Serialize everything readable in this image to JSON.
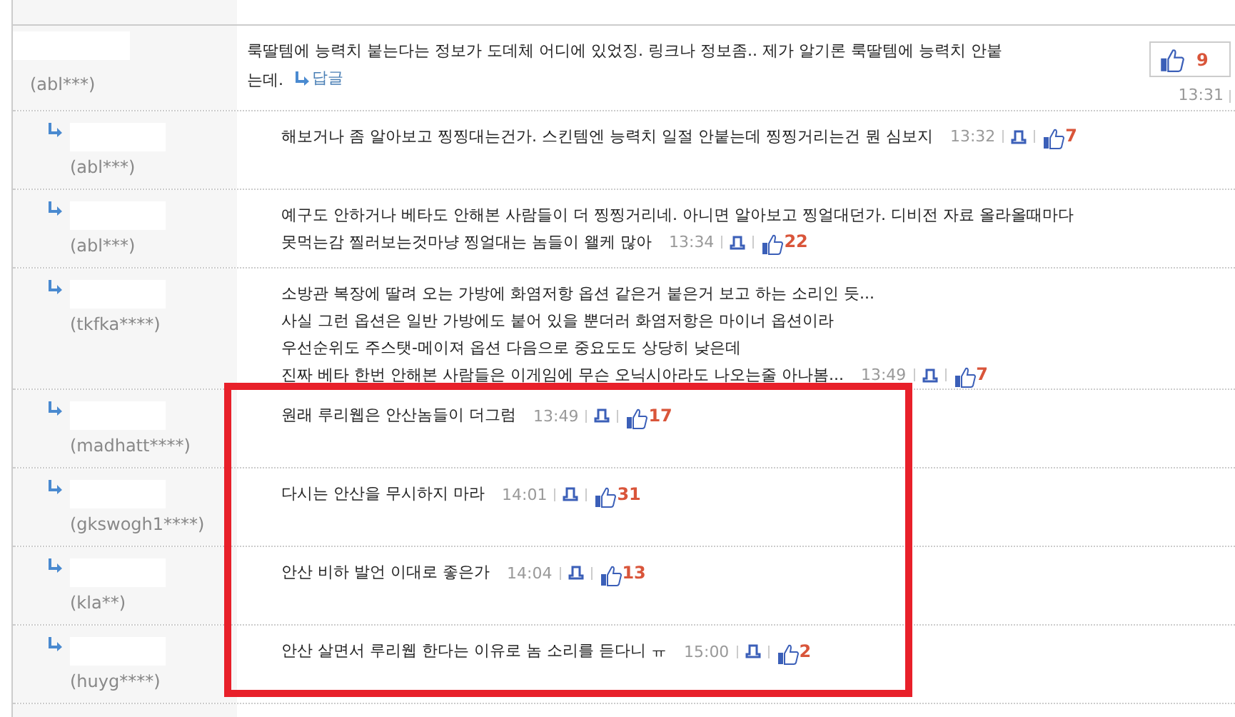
{
  "comments": [
    {
      "kind": "comment",
      "author": "(abl***)",
      "lines": [
        "룩딸템에 능력치 붙는다는 정보가 도데체 어디에 있었징. 링크나 정보좀.. 제가 알기론 룩딸템에 능력치 안붙",
        "는데."
      ],
      "reply_link": "답글",
      "time": "13:31",
      "likes": "9"
    },
    {
      "kind": "reply",
      "author": "(abl***)",
      "lines": [
        "해보거나 좀 알아보고 찡찡대는건가. 스킨템엔 능력치 일절 안붙는데 찡찡거리는건 뭔 심보지"
      ],
      "time": "13:32",
      "likes": "7"
    },
    {
      "kind": "reply",
      "author": "(abl***)",
      "lines": [
        "예구도 안하거나 베타도 안해본 사람들이 더 찡찡거리네. 아니면 알아보고 찡얼대던가. 디비전 자료 올라올때마다",
        "못먹는감 찔러보는것마냥 찡얼대는 놈들이 왤케 많아"
      ],
      "time": "13:34",
      "likes": "22"
    },
    {
      "kind": "reply",
      "author": "(tkfka****)",
      "lines": [
        "소방관 복장에 딸려 오는 가방에 화염저항 옵션 같은거 붙은거 보고 하는 소리인 듯...",
        "사실 그런 옵션은 일반 가방에도 붙어 있을 뿐더러 화염저항은 마이너 옵션이라",
        "우선순위도 주스탯-메이져 옵션 다음으로 중요도도 상당히 낮은데",
        "진짜 베타 한번 안해본 사람들은 이게임에 무슨 오닉시아라도 나오는줄 아나봄..."
      ],
      "time": "13:49",
      "likes": "7"
    },
    {
      "kind": "reply",
      "author": "(madhatt****)",
      "lines": [
        "원래 루리웹은 안산놈들이 더그럼"
      ],
      "time": "13:49",
      "likes": "17"
    },
    {
      "kind": "reply",
      "author": "(gkswogh1****)",
      "lines": [
        "다시는 안산을 무시하지 마라"
      ],
      "time": "14:01",
      "likes": "31"
    },
    {
      "kind": "reply",
      "author": "(kla**)",
      "lines": [
        "안산 비하 발언 이대로 좋은가"
      ],
      "time": "14:04",
      "likes": "13"
    },
    {
      "kind": "reply",
      "author": "(huyg****)",
      "lines": [
        "안산 살면서 루리웹 한다는 이유로 놈 소리를 듣다니 ㅠ"
      ],
      "time": "15:00",
      "likes": "2"
    }
  ],
  "annotation": {
    "kind": "rectangle",
    "color": "#e8202a"
  }
}
